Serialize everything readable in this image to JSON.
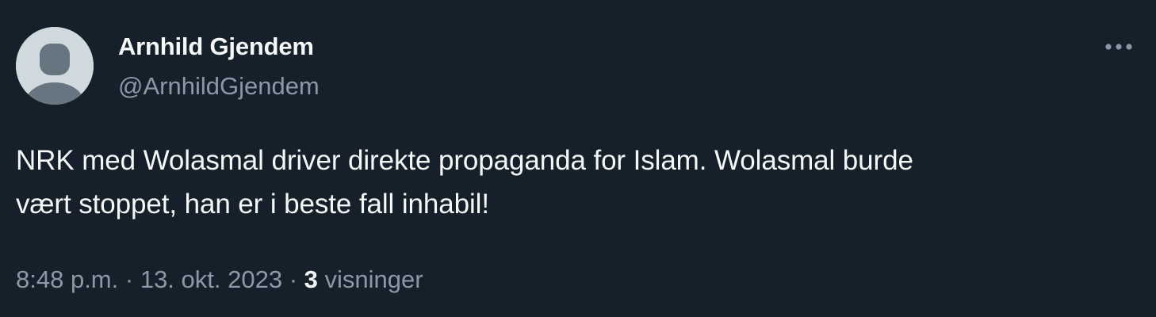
{
  "author": {
    "name": "Arnhild Gjendem",
    "handle": "@ArnhildGjendem"
  },
  "tweet": {
    "text_line_1": "NRK med Wolasmal driver direkte propaganda for Islam. Wolasmal burde",
    "text_line_2": "vært stoppet, han er i beste fall inhabil!",
    "time": "8:48 p.m.",
    "separator": "·",
    "date": "13. okt. 2023",
    "views_count": "3",
    "views_label": "visninger"
  },
  "icons": {
    "avatar": "default-avatar-icon",
    "more": "more-options-icon"
  },
  "colors": {
    "background": "#15202b",
    "primary_text": "#f7f9f9",
    "secondary_text": "#8b98a5",
    "avatar_bg": "#cfd9de",
    "avatar_figure": "#8b98a5"
  }
}
